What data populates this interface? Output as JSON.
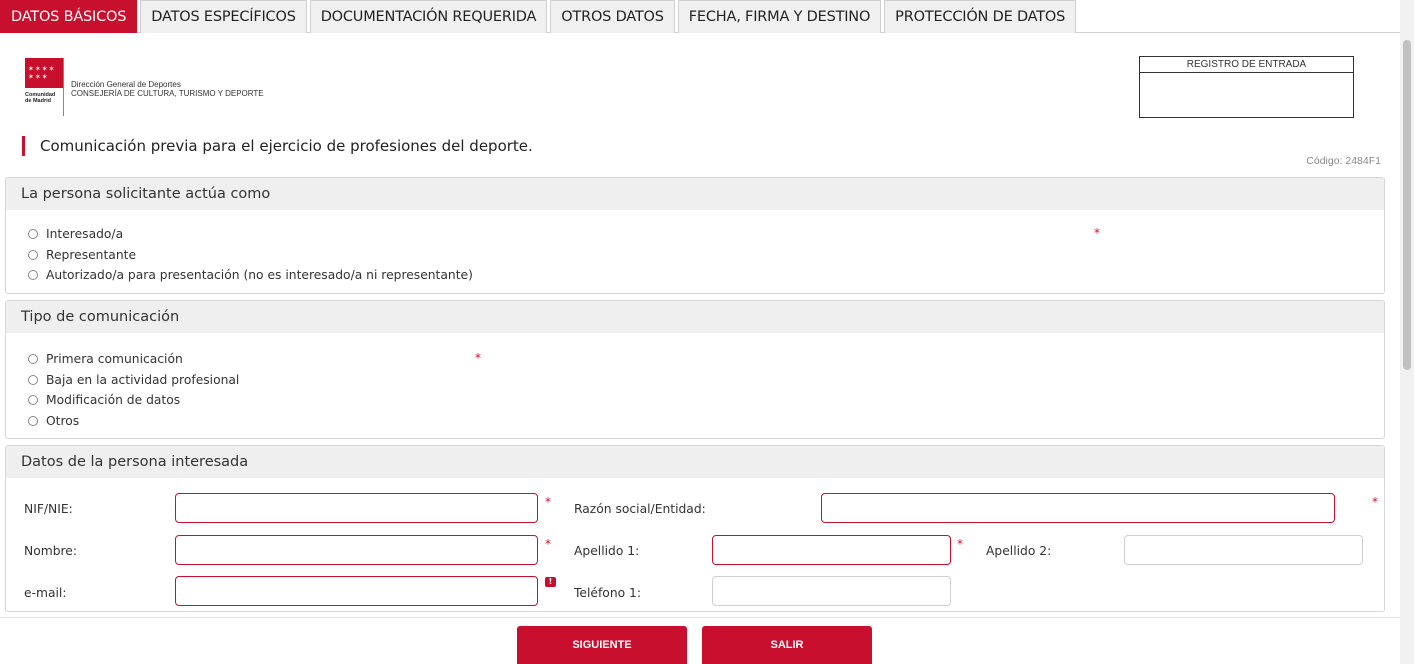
{
  "tabs": [
    {
      "label": "DATOS BÁSICOS",
      "active": true
    },
    {
      "label": "DATOS ESPECÍFICOS",
      "active": false
    },
    {
      "label": "DOCUMENTACIÓN REQUERIDA",
      "active": false
    },
    {
      "label": "OTROS DATOS",
      "active": false
    },
    {
      "label": "FECHA, FIRMA Y DESTINO",
      "active": false
    },
    {
      "label": "PROTECCIÓN DE DATOS",
      "active": false
    }
  ],
  "header": {
    "logo_text": "Comunidad de Madrid",
    "dept_line1": "Dirección General de Deportes",
    "dept_line2": "CONSEJERÍA DE CULTURA, TURISMO Y DEPORTE",
    "registro_title": "REGISTRO DE ENTRADA",
    "page_title": "Comunicación previa para el ejercicio de profesiones del deporte.",
    "codigo": "Código: 2484F1"
  },
  "section_actua": {
    "title": "La persona solicitante actúa como",
    "options": [
      "Interesado/a",
      "Representante",
      "Autorizado/a para presentación (no es interesado/a ni representante)"
    ]
  },
  "section_tipo": {
    "title": "Tipo de comunicación",
    "options": [
      "Primera comunicación",
      "Baja en la actividad profesional",
      "Modificación de datos",
      "Otros"
    ]
  },
  "section_datos": {
    "title": "Datos de la persona interesada",
    "nif_label": "NIF/NIE:",
    "razon_label": "Razón social/Entidad:",
    "nombre_label": "Nombre:",
    "apellido1_label": "Apellido 1:",
    "apellido2_label": "Apellido 2:",
    "email_label": "e-mail:",
    "telefono_label": "Teléfono 1:"
  },
  "buttons": {
    "siguiente": "SIGUIENTE",
    "salir": "SALIR"
  },
  "required_mark": "*",
  "icons": {
    "info": "info-icon",
    "radio": "radio-icon"
  },
  "colors": {
    "accent": "#c8102e",
    "section_header_bg": "#efefef"
  }
}
